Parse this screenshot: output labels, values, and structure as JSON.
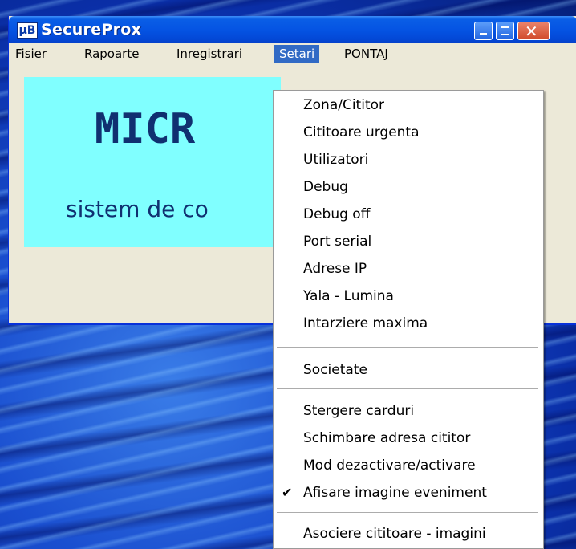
{
  "window": {
    "icon_label": "µB",
    "title": "SecureProx"
  },
  "menubar": {
    "items": [
      "Fisier",
      "Rapoarte",
      "Inregistrari",
      "Setari",
      "PONTAJ"
    ],
    "active": "Setari"
  },
  "banner": {
    "title": "MICR",
    "subtitle": "sistem de co"
  },
  "dropdown": {
    "items": [
      "Zona/Cititor",
      "Cititoare urgenta",
      "Utilizatori",
      "Debug",
      "Debug off",
      "Port serial",
      "Adrese IP",
      "Yala - Lumina",
      "Intarziere maxima",
      "Societate",
      "Stergere carduri",
      "Schimbare adresa cititor",
      "Mod dezactivare/activare",
      "Afisare imagine eveniment",
      "Asociere cititoare - imagini"
    ],
    "checked_item": "Afisare imagine eveniment",
    "check_glyph": "✔"
  },
  "colors": {
    "titlebar": "#0554e3",
    "menu_highlight": "#316ac5",
    "banner_bg": "#80ffff",
    "banner_text": "#103070"
  }
}
